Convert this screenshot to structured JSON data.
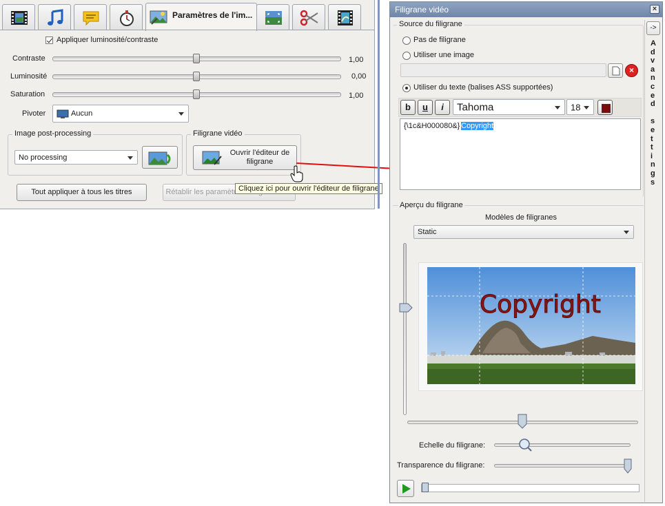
{
  "left_panel": {
    "tabs": [
      {
        "name": "video-tab",
        "icon": "film-icon"
      },
      {
        "name": "audio-tab",
        "icon": "music-note-icon"
      },
      {
        "name": "subtitles-tab",
        "icon": "speech-bubble-icon"
      },
      {
        "name": "chapters-tab",
        "icon": "stopwatch-icon"
      },
      {
        "name": "image-settings-tab",
        "icon": "image-settings-icon",
        "label": "Paramètres de l'im..."
      },
      {
        "name": "crop-tab",
        "icon": "crop-icon"
      },
      {
        "name": "cut-tab",
        "icon": "scissors-icon"
      },
      {
        "name": "effects-tab",
        "icon": "film-effects-icon"
      }
    ],
    "apply_brightness_label": "Appliquer luminosité/contraste",
    "contrast": {
      "label": "Contraste",
      "value": "1,00",
      "level": 0.5
    },
    "brightness": {
      "label": "Luminosité",
      "value": "0,00",
      "level": 0.5
    },
    "saturation": {
      "label": "Saturation",
      "value": "1,00",
      "level": 0.5
    },
    "rotate": {
      "label": "Pivoter",
      "value": "Aucun"
    },
    "postprocessing": {
      "title": "Image post-processing",
      "value": "No processing"
    },
    "watermark_group": {
      "title": "Filigrane vidéo",
      "open_editor_label": "Ouvrir l'éditeur de filigrane"
    },
    "apply_all_label": "Tout appliquer à tous les titres",
    "reset_label": "Rétablir les paramètres image initiaux",
    "tooltip": "Cliquez ici pour ouvrir l'éditeur de filigrane"
  },
  "right_panel": {
    "title": "Filigrane vidéo",
    "source": {
      "title": "Source du filigrane",
      "no_watermark": "Pas de filigrane",
      "use_image": "Utiliser une image",
      "image_path": "",
      "use_text": "Utiliser du texte (balises ASS supportées)",
      "selected": "text"
    },
    "format": {
      "bold": "b",
      "underline": "u",
      "italic": "i",
      "font": "Tahoma",
      "size": "18",
      "color": "#7b0c0c"
    },
    "text_prefix": "{\\1c&H000080&}",
    "text_selected": "Copyright",
    "preview": {
      "title": "Aperçu du filigrane",
      "templates_label": "Modèles de filigranes",
      "template_value": "Static",
      "watermark_text": "Copyright",
      "scale_label": "Echelle du filigrane:",
      "scale_level": 0.23,
      "transparency_label": "Transparence du filigrane:",
      "transparency_level": 1.0,
      "horizontal_position": 0.5,
      "vertical_position": 0.38
    },
    "advanced_button": "->",
    "advanced_label": [
      "A",
      "d",
      "v",
      "a",
      "n",
      "c",
      "e",
      "d",
      "",
      "s",
      "e",
      "t",
      "t",
      "i",
      "n",
      "g",
      "s"
    ]
  },
  "colors": {
    "title_bar": "#7a90b2",
    "selection": "#3399ff",
    "watermark_text": "#8a1515",
    "arrow": "#e01010"
  }
}
